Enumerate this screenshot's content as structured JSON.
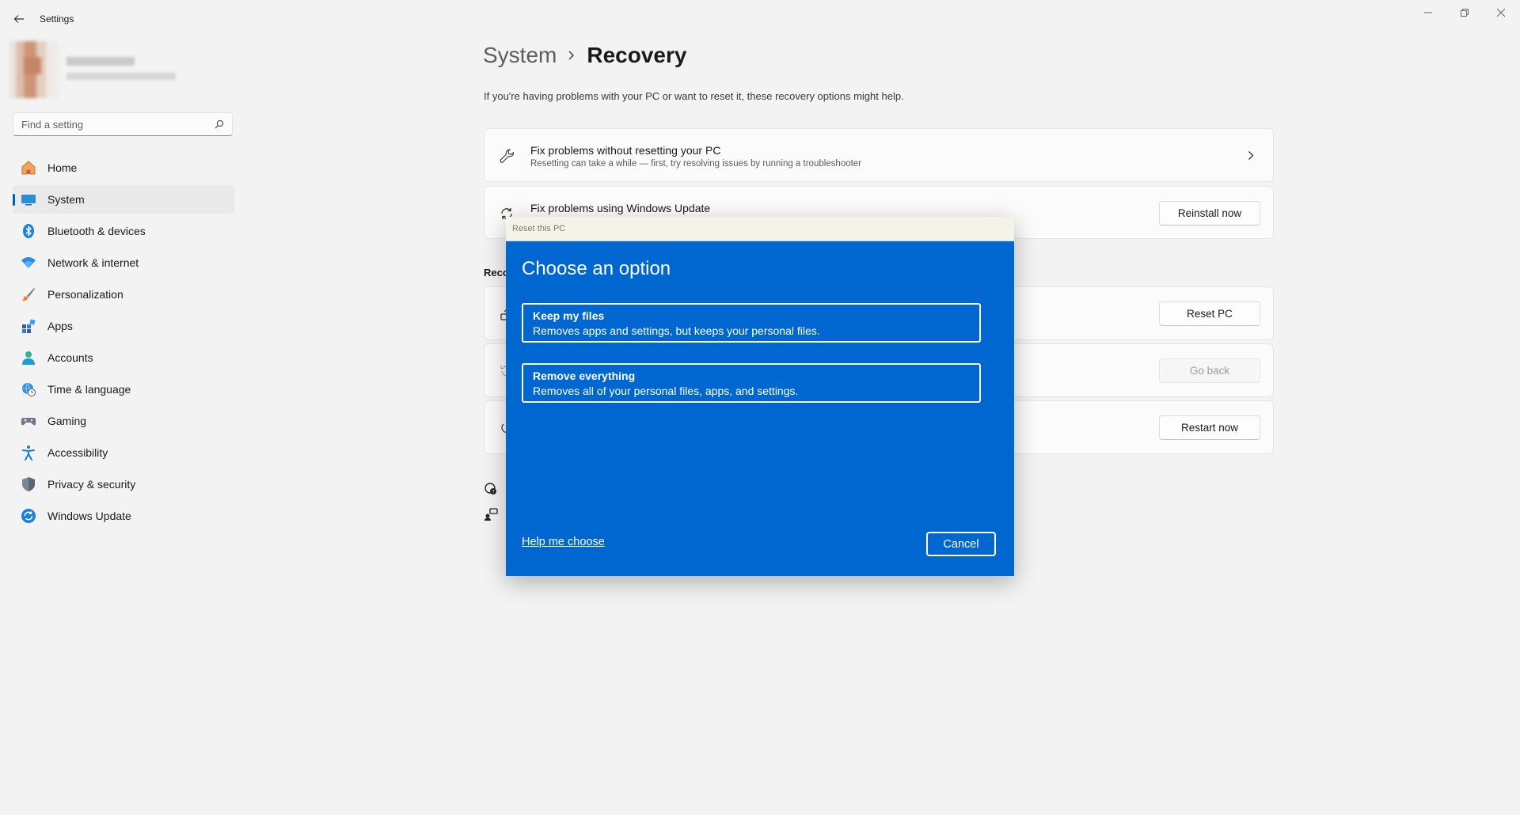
{
  "window": {
    "title": "Settings",
    "controls": [
      "minimize-icon",
      "restore-icon",
      "close-icon"
    ]
  },
  "search": {
    "placeholder": "Find a setting"
  },
  "sidebar": {
    "items": [
      {
        "label": "Home",
        "icon": "home-icon"
      },
      {
        "label": "System",
        "icon": "system-icon",
        "active": true
      },
      {
        "label": "Bluetooth & devices",
        "icon": "bluetooth-icon"
      },
      {
        "label": "Network & internet",
        "icon": "wifi-icon"
      },
      {
        "label": "Personalization",
        "icon": "brush-icon"
      },
      {
        "label": "Apps",
        "icon": "apps-icon"
      },
      {
        "label": "Accounts",
        "icon": "person-icon"
      },
      {
        "label": "Time & language",
        "icon": "globe-clock-icon"
      },
      {
        "label": "Gaming",
        "icon": "gamepad-icon"
      },
      {
        "label": "Accessibility",
        "icon": "accessibility-icon"
      },
      {
        "label": "Privacy & security",
        "icon": "shield-icon"
      },
      {
        "label": "Windows Update",
        "icon": "update-icon"
      }
    ]
  },
  "main": {
    "breadcrumb": {
      "parent": "System",
      "current": "Recovery"
    },
    "subtitle": "If you're having problems with your PC or want to reset it, these recovery options might help.",
    "cards": {
      "fix_without_reset": {
        "title": "Fix problems without resetting your PC",
        "description": "Resetting can take a while — first, try resolving issues by running a troubleshooter"
      },
      "windows_update": {
        "title": "Fix problems using Windows Update",
        "button": "Reinstall now"
      }
    },
    "section_heading": "Reco",
    "buttons": {
      "reset_pc": "Reset PC",
      "go_back": "Go back",
      "restart_now": "Restart now"
    }
  },
  "dialog": {
    "title": "Reset this PC",
    "heading": "Choose an option",
    "options": [
      {
        "title": "Keep my files",
        "description": "Removes apps and settings, but keeps your personal files."
      },
      {
        "title": "Remove everything",
        "description": "Removes all of your personal files, apps, and settings."
      }
    ],
    "help_link": "Help me choose",
    "cancel": "Cancel"
  },
  "colors": {
    "accent": "#005fb8",
    "dialog_bg": "#0067d0",
    "page_bg": "#f3f3f3"
  }
}
